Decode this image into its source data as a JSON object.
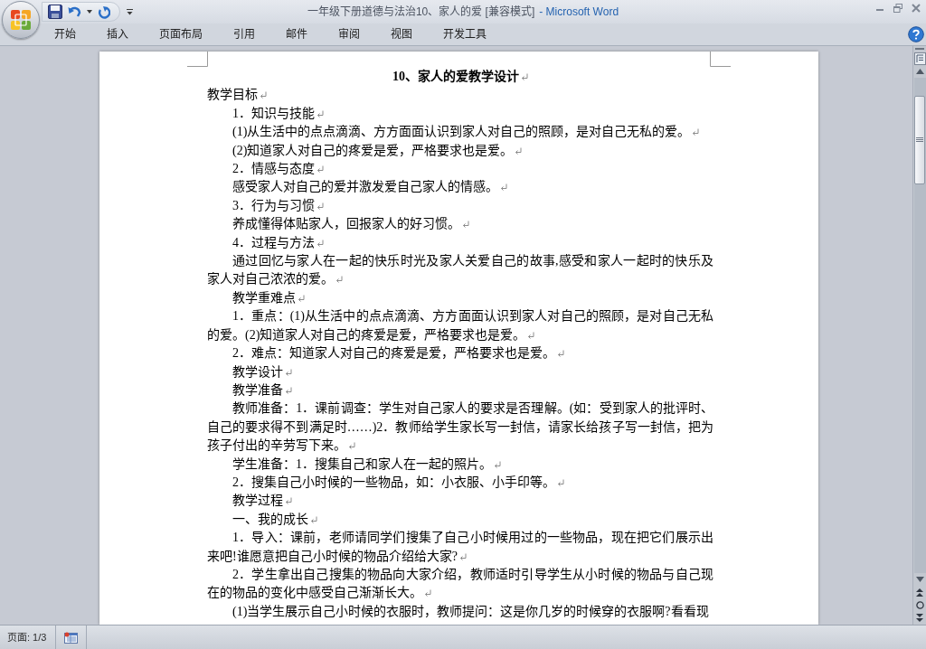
{
  "window": {
    "document_title": "一年级下册道德与法治10、家人的爱 [兼容模式]",
    "app_name": "- Microsoft Word"
  },
  "ribbon_tabs": [
    {
      "label": "开始",
      "selected": false
    },
    {
      "label": "插入",
      "selected": false
    },
    {
      "label": "页面布局",
      "selected": false
    },
    {
      "label": "引用",
      "selected": false
    },
    {
      "label": "邮件",
      "selected": false
    },
    {
      "label": "审阅",
      "selected": false
    },
    {
      "label": "视图",
      "selected": false
    },
    {
      "label": "开发工具",
      "selected": false
    }
  ],
  "document": {
    "paragraphs": [
      {
        "kind": "title",
        "text": "10、家人的爱教学设计",
        "end_mark": true
      },
      {
        "kind": "flush",
        "text": "教学目标",
        "end_mark": true
      },
      {
        "kind": "indented",
        "text": "1．知识与技能",
        "end_mark": true
      },
      {
        "kind": "indented",
        "text": "(1)从生活中的点点滴滴、方方面面认识到家人对自己的照顾，是对自己无私的爱。",
        "end_mark": true
      },
      {
        "kind": "indented",
        "text": "(2)知道家人对自己的疼爱是爱，严格要求也是爱。",
        "end_mark": true
      },
      {
        "kind": "indented",
        "text": "2．情感与态度",
        "end_mark": true
      },
      {
        "kind": "indented",
        "text": "感受家人对自己的爱并激发爱自己家人的情感。",
        "end_mark": true
      },
      {
        "kind": "indented",
        "text": "3．行为与习惯",
        "end_mark": true
      },
      {
        "kind": "indented",
        "text": "养成懂得体贴家人，回报家人的好习惯。",
        "end_mark": true
      },
      {
        "kind": "indented",
        "text": "4．过程与方法",
        "end_mark": true
      },
      {
        "kind": "indented",
        "text": "通过回忆与家人在一起的快乐时光及家人关爱自己的故事,感受和家人一起时的快乐及家人对自己浓浓的爱。",
        "end_mark": true
      },
      {
        "kind": "indented",
        "text": "教学重难点",
        "end_mark": true
      },
      {
        "kind": "indented",
        "text": "1．重点：(1)从生活中的点点滴滴、方方面面认识到家人对自己的照顾，是对自己无私的爱。(2)知道家人对自己的疼爱是爱，严格要求也是爱。",
        "end_mark": true
      },
      {
        "kind": "indented",
        "text": "2．难点：知道家人对自己的疼爱是爱，严格要求也是爱。",
        "end_mark": true
      },
      {
        "kind": "indented",
        "text": "教学设计",
        "end_mark": true
      },
      {
        "kind": "indented",
        "text": "教学准备",
        "end_mark": true
      },
      {
        "kind": "indented",
        "text": "教师准备：1．课前调查：学生对自己家人的要求是否理解。(如：受到家人的批评时、自己的要求得不到满足时……)2．教师给学生家长写一封信，请家长给孩子写一封信，把为孩子付出的辛劳写下来。",
        "end_mark": true
      },
      {
        "kind": "indented",
        "text": "学生准备：1．搜集自己和家人在一起的照片。",
        "end_mark": true
      },
      {
        "kind": "indented",
        "text": "2．搜集自己小时候的一些物品，如：小衣服、小手印等。",
        "end_mark": true
      },
      {
        "kind": "indented",
        "text": "教学过程",
        "end_mark": true
      },
      {
        "kind": "indented",
        "text": "一、我的成长",
        "end_mark": true
      },
      {
        "kind": "indented",
        "text": "1．导入：课前，老师请同学们搜集了自己小时候用过的一些物品，现在把它们展示出来吧!谁愿意把自己小时候的物品介绍给大家?",
        "end_mark": true
      },
      {
        "kind": "indented",
        "text": "2．学生拿出自己搜集的物品向大家介绍，教师适时引导学生从小时候的物品与自己现在的物品的变化中感受自己渐渐长大。",
        "end_mark": true
      },
      {
        "kind": "indented",
        "text": "(1)当学生展示自己小时候的衣服时，教师提问：这是你几岁的时候穿的衣服啊?看看现",
        "end_mark": false
      }
    ]
  },
  "status_bar": {
    "page": "页面: 1/3"
  }
}
